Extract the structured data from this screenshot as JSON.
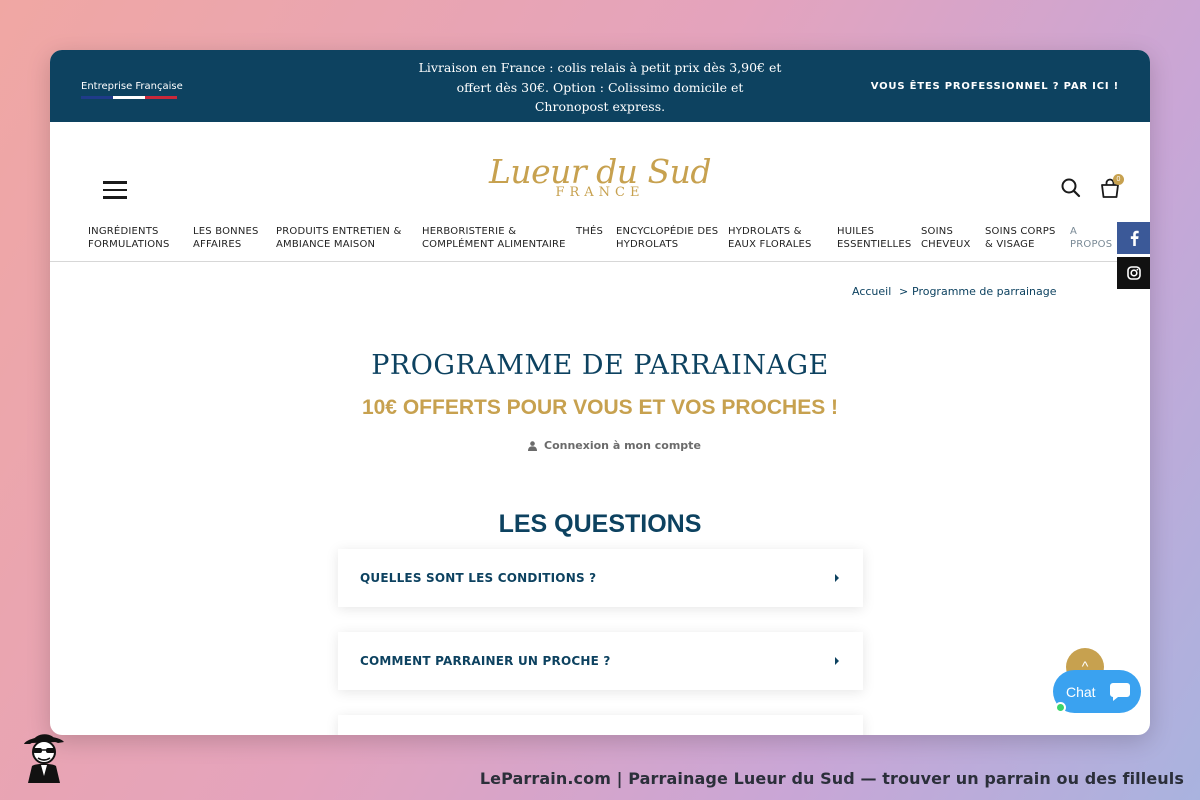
{
  "topbar": {
    "company": "Entreprise Française",
    "promo_line1": "Livraison en France : colis relais à petit prix dès 3,90€ et",
    "promo_line2": "offert dès 30€. Option : Colissimo domicile et",
    "promo_line3": "Chronopost express.",
    "pro_link": "VOUS ÊTES PROFESSIONNEL ? PAR ICI !",
    "flag_colors": [
      "#1f3b8a",
      "#ffffff",
      "#c8283a"
    ]
  },
  "logo": {
    "script": "Lueur du Sud",
    "sub": "FRANCE"
  },
  "header": {
    "menu_icon": "hamburger-menu-icon",
    "search_icon": "search-icon",
    "cart_icon": "shopping-bag-icon",
    "cart_count": "0"
  },
  "nav": {
    "items": [
      {
        "line1": "INGRÉDIENTS",
        "line2": "FORMULATIONS"
      },
      {
        "line1": "LES BONNES",
        "line2": "AFFAIRES"
      },
      {
        "line1": "PRODUITS ENTRETIEN &",
        "line2": "AMBIANCE MAISON"
      },
      {
        "line1": "HERBORISTERIE &",
        "line2": "COMPLÉMENT ALIMENTAIRE"
      },
      {
        "line1": "THÉS",
        "line2": ""
      },
      {
        "line1": "ENCYCLOPÉDIE DES",
        "line2": "HYDROLATS"
      },
      {
        "line1": "HYDROLATS &",
        "line2": "EAUX FLORALES"
      },
      {
        "line1": "HUILES",
        "line2": "ESSENTIELLES"
      },
      {
        "line1": "SOINS",
        "line2": "CHEVEUX"
      },
      {
        "line1": "SOINS CORPS",
        "line2": "& VISAGE"
      },
      {
        "line1": "A",
        "line2": "PROPOS"
      }
    ]
  },
  "social": {
    "facebook": "facebook-icon",
    "instagram": "instagram-icon"
  },
  "breadcrumb": {
    "home": "Accueil",
    "separator": ">",
    "current": "Programme de parrainage"
  },
  "main": {
    "title": "PROGRAMME DE PARRAINAGE",
    "subtitle": "10€ OFFERTS POUR VOUS ET VOS PROCHES !",
    "login": "Connexion à mon compte",
    "questions_title": "LES QUESTIONS",
    "faq": [
      "QUELLES SONT LES CONDITIONS ?",
      "COMMENT PARRAINER UN PROCHE ?",
      ""
    ]
  },
  "widgets": {
    "scroll_top": "^",
    "chat_label": "Chat"
  },
  "caption": "LeParrain.com | Parrainage Lueur du Sud — trouver un parrain ou des filleuls",
  "colors": {
    "navy": "#0d4260",
    "gold": "#c7a14f",
    "chat_blue": "#3aa2f0"
  }
}
